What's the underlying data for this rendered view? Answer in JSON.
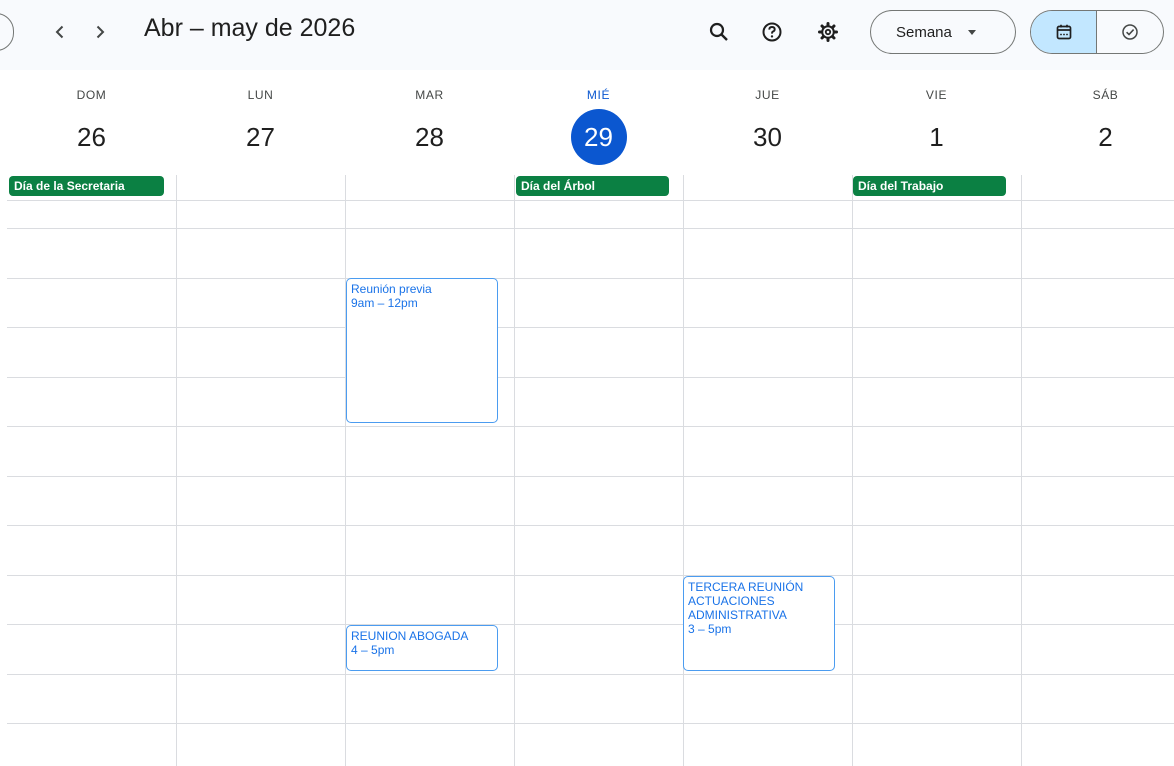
{
  "header": {
    "title": "Abr – may de 2026",
    "view_label": "Semana",
    "icons": {
      "prev": "chevron-left-icon",
      "next": "chevron-right-icon",
      "search": "search-icon",
      "help": "help-icon",
      "settings": "gear-icon",
      "calendar": "calendar-icon",
      "tasks": "check-circle-icon"
    }
  },
  "days": [
    {
      "dow": "DOM",
      "num": "26"
    },
    {
      "dow": "LUN",
      "num": "27"
    },
    {
      "dow": "MAR",
      "num": "28"
    },
    {
      "dow": "MIÉ",
      "num": "29",
      "today": true
    },
    {
      "dow": "JUE",
      "num": "30"
    },
    {
      "dow": "VIE",
      "num": "1"
    },
    {
      "dow": "SÁB",
      "num": "2"
    }
  ],
  "all_day_events": [
    {
      "day": "DOM 26",
      "title": "Día de la Secretaria"
    },
    {
      "day": "MIÉ 29",
      "title": "Día del Árbol"
    },
    {
      "day": "VIE 1",
      "title": "Día del Trabajo"
    }
  ],
  "events": [
    {
      "day": "MAR 28",
      "title": "Reunión previa",
      "time": "9am – 12pm"
    },
    {
      "day": "MAR 28",
      "title": "REUNION ABOGADA",
      "time": "4 – 5pm"
    },
    {
      "day": "JUE 30",
      "title": "TERCERA REUNIÓN ACTUACIONES ADMINISTRATIVA",
      "time": "3 – 5pm"
    }
  ],
  "colors": {
    "today_accent": "#0b57d0",
    "holiday_green": "#0b8043",
    "event_border": "#4b9cf0",
    "event_text": "#1a73e8",
    "active_toggle": "#c2e7ff",
    "header_bg": "#f8fafd"
  }
}
